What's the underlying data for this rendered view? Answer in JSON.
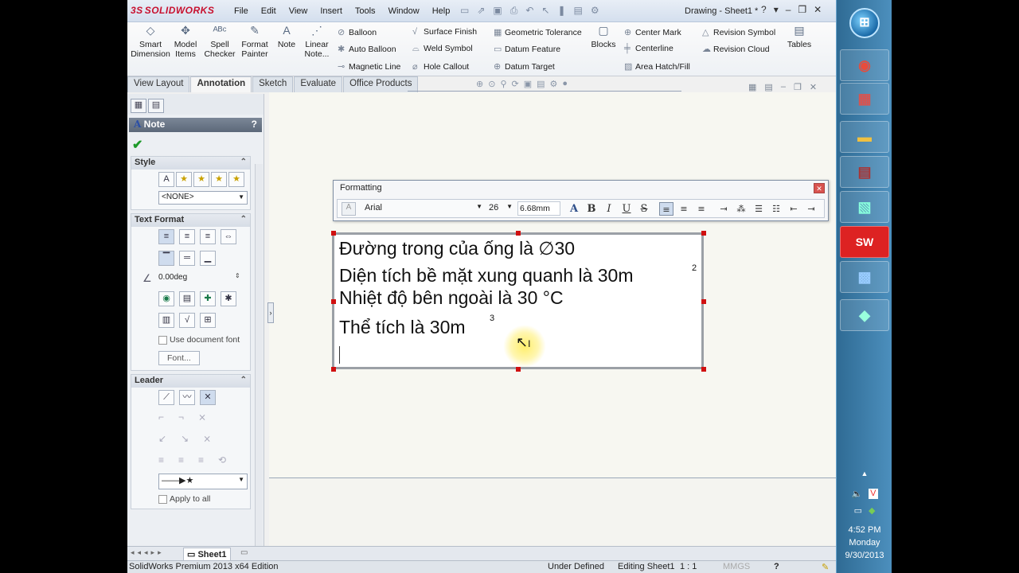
{
  "app": {
    "logo": "SOLIDWORKS",
    "menu": [
      "File",
      "Edit",
      "View",
      "Insert",
      "Tools",
      "Window",
      "Help"
    ],
    "doc_title": "Drawing - Sheet1 *"
  },
  "ribbon": {
    "big": [
      {
        "label": "Smart Dimension",
        "icon": "smart-dimension-icon"
      },
      {
        "label": "Model Items",
        "icon": "model-items-icon"
      },
      {
        "label": "Spell Checker",
        "icon": "spell-checker-icon"
      },
      {
        "label": "Format Painter",
        "icon": "format-painter-icon"
      },
      {
        "label": "Note",
        "icon": "note-icon"
      },
      {
        "label": "Linear Note...",
        "icon": "linear-note-icon"
      }
    ],
    "col1": [
      "Balloon",
      "Auto Balloon",
      "Magnetic Line"
    ],
    "col2": [
      "Surface Finish",
      "Weld Symbol",
      "Hole Callout"
    ],
    "col3": [
      "Geometric Tolerance",
      "Datum Feature",
      "Datum Target"
    ],
    "blocks": "Blocks",
    "col4": [
      "Center Mark",
      "Centerline",
      "Area Hatch/Fill"
    ],
    "col5": [
      "Revision Symbol",
      "Revision Cloud"
    ],
    "tables": "Tables"
  },
  "tabs": [
    "View Layout",
    "Annotation",
    "Sketch",
    "Evaluate",
    "Office Products"
  ],
  "active_tab": "Annotation",
  "panel": {
    "title": "Note",
    "help": "?",
    "style": {
      "header": "Style",
      "dropdown": "<NONE>"
    },
    "text_format": {
      "header": "Text Format",
      "angle": "0.00deg",
      "use_doc_font": "Use document font",
      "font_button": "Font..."
    },
    "leader": {
      "header": "Leader",
      "apply_all": "Apply to all"
    }
  },
  "formatting": {
    "title": "Formatting",
    "font": "Arial",
    "size": "26",
    "height": "6.68mm"
  },
  "note": {
    "lines": [
      "Đường trong của ống là  ∅30",
      "Diện tích bề mặt xung quanh là 30m",
      "Nhiệt độ bên ngoài là 30 °C",
      "Thể tích là 30m"
    ],
    "sup2": "2",
    "sup3": "3"
  },
  "bottom": {
    "sheet_tab": "Sheet1"
  },
  "status": {
    "edition": "SolidWorks Premium 2013 x64 Edition",
    "defined": "Under Defined",
    "editing": "Editing Sheet1",
    "scale": "1 : 1",
    "units": "MMGS"
  },
  "taskbar": {
    "time": "4:52 PM",
    "day": "Monday",
    "date": "9/30/2013"
  }
}
